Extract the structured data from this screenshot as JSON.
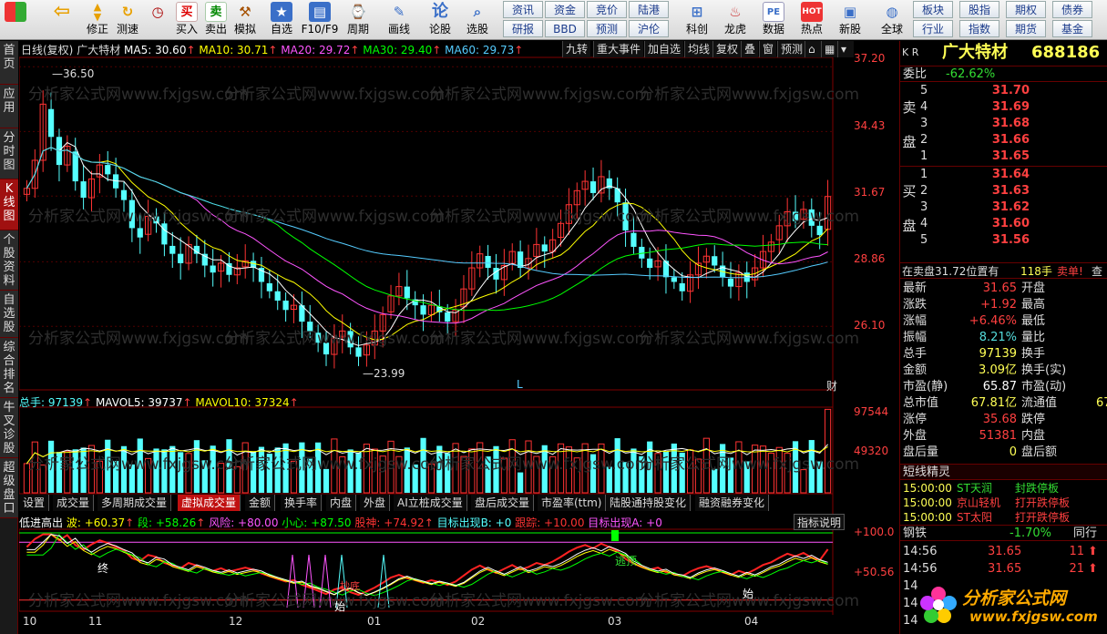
{
  "toolbar": {
    "buttons": [
      {
        "name": "windows",
        "label": "",
        "icon": "windows-icon"
      },
      {
        "name": "back",
        "label": "",
        "icon": "back-arrow-icon"
      },
      {
        "name": "updown",
        "label": "修正",
        "icon": "updown-icon"
      },
      {
        "name": "revise",
        "label": "修正",
        "icon": "revise-icon"
      },
      {
        "name": "measure",
        "label": "测速",
        "icon": "clock-icon"
      },
      {
        "name": "buy",
        "label": "买入",
        "icon_text": "买"
      },
      {
        "name": "sell",
        "label": "卖出",
        "icon_text": "卖"
      },
      {
        "name": "simulate",
        "label": "模拟",
        "icon": "hammer-icon"
      },
      {
        "name": "watchlist",
        "label": "自选",
        "icon": "star-icon"
      },
      {
        "name": "f10",
        "label": "F10/F9",
        "icon": "doc-icon"
      },
      {
        "name": "period",
        "label": "周期",
        "icon": "period-icon"
      },
      {
        "name": "draw",
        "label": "画线",
        "icon": "pen-icon"
      },
      {
        "name": "discuss",
        "label": "论股",
        "icon_text": "论"
      },
      {
        "name": "pick",
        "label": "选股",
        "icon": "magnifier-icon"
      }
    ],
    "small_buttons_row1": [
      "资讯",
      "资金",
      "竞价",
      "陆港"
    ],
    "small_buttons_row2": [
      "研报",
      "BBD",
      "预测",
      "沪伦"
    ],
    "buttons2": [
      {
        "name": "kechuang",
        "label": "科创"
      },
      {
        "name": "longhu",
        "label": "龙虎"
      },
      {
        "name": "data",
        "label": "数据",
        "icon_text": "PE"
      },
      {
        "name": "hot",
        "label": "热点",
        "icon_text": "HOT"
      },
      {
        "name": "newstock",
        "label": "新股"
      },
      {
        "name": "global",
        "label": "全球"
      }
    ],
    "right_row1": [
      "板块",
      "股指",
      "期权",
      "债券"
    ],
    "right_row2": [
      "行业",
      "指数",
      "期货",
      "基金"
    ]
  },
  "left_tabs": [
    "首页",
    "应用",
    "分时图",
    "K线图",
    "个股资料",
    "自选股",
    "综合排名",
    "牛叉诊股",
    "超级盘口"
  ],
  "chart": {
    "period_label": "日线(复权)",
    "stock_name": "广大特材",
    "ma": [
      {
        "label": "MA5: 30.60",
        "color": "#ffffff"
      },
      {
        "label": "MA10: 30.71",
        "color": "#ffff00"
      },
      {
        "label": "MA20: 29.72",
        "color": "#ff55ff"
      },
      {
        "label": "MA30: 29.40",
        "color": "#00ff00"
      },
      {
        "label": "MA60: 29.73",
        "color": "#55ccff"
      }
    ],
    "menu": [
      "九转",
      "重大事件",
      "加自选",
      "均线",
      "复权",
      "叠",
      "窗",
      "预测",
      "",
      "",
      ""
    ],
    "price_ticks": [
      "37.20",
      "34.43",
      "31.67",
      "28.86",
      "26.10"
    ],
    "high_label": "36.50",
    "low_label": "23.99",
    "L_marker": "L",
    "cai_marker": "财",
    "volume": {
      "legend": [
        {
          "label": "总手: 97139",
          "color": "#55ffff"
        },
        {
          "label": "MAVOL5: 39737",
          "color": "#ffffff"
        },
        {
          "label": "MAVOL10: 37324",
          "color": "#ffff00"
        }
      ],
      "ticks": [
        "97544",
        "49320"
      ]
    },
    "indicator_tabs": [
      "设置",
      "成交量",
      "多周期成交量",
      "虚拟成交量",
      "金额",
      "换手率",
      "内盘",
      "外盘",
      "AI立桩成交量",
      "盘后成交量",
      "市盈率(ttm)",
      "陆股通持股变化",
      "融资融券变化"
    ],
    "indicator_active": "虚拟成交量",
    "indicator": {
      "legend": [
        {
          "label": "低进高出",
          "color": "#ffffff"
        },
        {
          "label": "波: +60.37",
          "color": "#ffff00"
        },
        {
          "label": "段: +58.26",
          "color": "#00ff00"
        },
        {
          "label": "风险: +80.00",
          "color": "#ff55ff"
        },
        {
          "label": "小心: +87.50",
          "color": "#00ff00"
        },
        {
          "label": "股神: +74.92",
          "color": "#ff3333"
        },
        {
          "label": "目标出现B: +0",
          "color": "#55ffff"
        },
        {
          "label": "跟踪: +10.00",
          "color": "#ff3333"
        },
        {
          "label": "目标出现A: +0",
          "color": "#ff55ff"
        }
      ],
      "help": "指标说明",
      "ticks": [
        "+100.0",
        "+50.56"
      ],
      "markers": [
        "终",
        "抄底",
        "始",
        "逃顶",
        "始"
      ]
    },
    "x_labels": [
      "10",
      "11",
      "12",
      "01",
      "02",
      "03",
      "04"
    ],
    "watermark": "分析家公式网www.fxjgsw.com"
  },
  "chart_data": {
    "type": "candlestick",
    "title": "广大特材 日线(复权)",
    "x_ticks": [
      "10",
      "11",
      "12",
      "01",
      "02",
      "03",
      "04"
    ],
    "y_ticks": [
      37.2,
      34.43,
      31.67,
      28.86,
      26.1
    ],
    "ylim": [
      23.5,
      37.6
    ],
    "annotations": [
      {
        "text": "36.50",
        "value": 36.5
      },
      {
        "text": "23.99",
        "value": 23.99
      }
    ],
    "ohlc_close": [
      32.0,
      33.2,
      35.6,
      34.2,
      33.0,
      33.8,
      32.3,
      31.6,
      32.4,
      33.0,
      32.6,
      32.0,
      31.5,
      30.3,
      29.9,
      30.8,
      30.5,
      29.6,
      29.2,
      28.8,
      29.6,
      29.2,
      28.7,
      28.4,
      28.8,
      28.3,
      28.6,
      28.9,
      28.6,
      28.0,
      27.6,
      27.2,
      26.8,
      27.0,
      26.3,
      25.9,
      25.4,
      24.9,
      25.6,
      25.9,
      25.2,
      24.8,
      25.3,
      25.9,
      26.6,
      27.4,
      27.8,
      27.3,
      27.0,
      26.6,
      27.0,
      26.7,
      26.3,
      26.8,
      27.7,
      28.6,
      29.2,
      28.6,
      28.1,
      28.7,
      29.3,
      28.6,
      29.0,
      29.6,
      29.3,
      29.8,
      30.5,
      31.3,
      31.9,
      32.3,
      31.8,
      32.5,
      32.0,
      31.4,
      30.2,
      29.5,
      29.0,
      28.6,
      28.9,
      28.2,
      28.0,
      27.6,
      28.3,
      28.8,
      29.1,
      28.7,
      28.2,
      27.8,
      28.4,
      28.0,
      28.6,
      29.3,
      29.7,
      30.4,
      31.0,
      30.6,
      31.1,
      30.4,
      30.0,
      31.65
    ],
    "volume_ticks": [
      97544,
      49320
    ],
    "indicator_ticks": [
      100.0,
      50.56
    ]
  },
  "right": {
    "kr": "K R",
    "name": "广大特材",
    "code": "688186",
    "weibi_label": "委比",
    "weibi_value": "-62.62%",
    "sell_label": "卖盘",
    "buy_label": "买盘",
    "asks": [
      {
        "lvl": "5",
        "px": "31.70"
      },
      {
        "lvl": "4",
        "px": "31.69"
      },
      {
        "lvl": "3",
        "px": "31.68"
      },
      {
        "lvl": "2",
        "px": "31.66"
      },
      {
        "lvl": "1",
        "px": "31.65"
      }
    ],
    "bids": [
      {
        "lvl": "1",
        "px": "31.64"
      },
      {
        "lvl": "2",
        "px": "31.63"
      },
      {
        "lvl": "3",
        "px": "31.62"
      },
      {
        "lvl": "4",
        "px": "31.60"
      },
      {
        "lvl": "5",
        "px": "31.56"
      }
    ],
    "sell_note": "在卖盘31.72位置有",
    "sell_note_qty": "118手",
    "sell_note_tag": "卖单!",
    "sell_note_link": "查",
    "stats": [
      {
        "k": "最新",
        "v": "31.65",
        "vc": "red",
        "k2": "开盘",
        "v2": ""
      },
      {
        "k": "涨跌",
        "v": "+1.92",
        "vc": "red",
        "k2": "最高",
        "v2": ""
      },
      {
        "k": "涨幅",
        "v": "+6.46%",
        "vc": "red",
        "k2": "最低",
        "v2": ""
      },
      {
        "k": "振幅",
        "v": "8.21%",
        "vc": "cyn",
        "k2": "量比",
        "v2": ""
      },
      {
        "k": "总手",
        "v": "97139",
        "vc": "yel",
        "k2": "换手",
        "v2": ""
      },
      {
        "k": "金额",
        "v": "3.09亿",
        "vc": "yel",
        "k2": "换手(实)",
        "v2": ""
      },
      {
        "k": "市盈(静)",
        "v": "65.87",
        "vc": "white",
        "k2": "市盈(动)",
        "v2": ""
      },
      {
        "k": "总市值",
        "v": "67.81亿",
        "vc": "yel",
        "k2": "流通值",
        "v2": "67"
      },
      {
        "k": "涨停",
        "v": "35.68",
        "vc": "red",
        "k2": "跌停",
        "v2": ""
      },
      {
        "k": "外盘",
        "v": "51381",
        "vc": "red",
        "k2": "内盘",
        "v2": ""
      },
      {
        "k": "盘后量",
        "v": "0",
        "vc": "yel",
        "k2": "盘后额",
        "v2": ""
      }
    ],
    "short_title": "短线精灵",
    "short_items": [
      {
        "time": "15:00:00",
        "name": "ST天润",
        "event": "封跌停板",
        "nc": "grn",
        "ec": "grn"
      },
      {
        "time": "15:00:00",
        "name": "京山轻机",
        "event": "打开跌停板",
        "nc": "red",
        "ec": "red"
      },
      {
        "time": "15:00:00",
        "name": "ST太阳",
        "event": "打开跌停板",
        "nc": "red",
        "ec": "red"
      }
    ],
    "sector_name": "钢铁",
    "sector_chg": "-1.70%",
    "sector_tag": "同行",
    "ticks": [
      {
        "time": "14:56",
        "px": "31.65",
        "vol": "11"
      },
      {
        "time": "14:56",
        "px": "31.65",
        "vol": "21"
      },
      {
        "time": "14",
        "px": "",
        "vol": ""
      },
      {
        "time": "14",
        "px": "",
        "vol": ""
      },
      {
        "time": "14",
        "px": "",
        "vol": ""
      }
    ],
    "logo_text": "分析家公式网",
    "logo_url": "www.fxjgsw.com"
  }
}
